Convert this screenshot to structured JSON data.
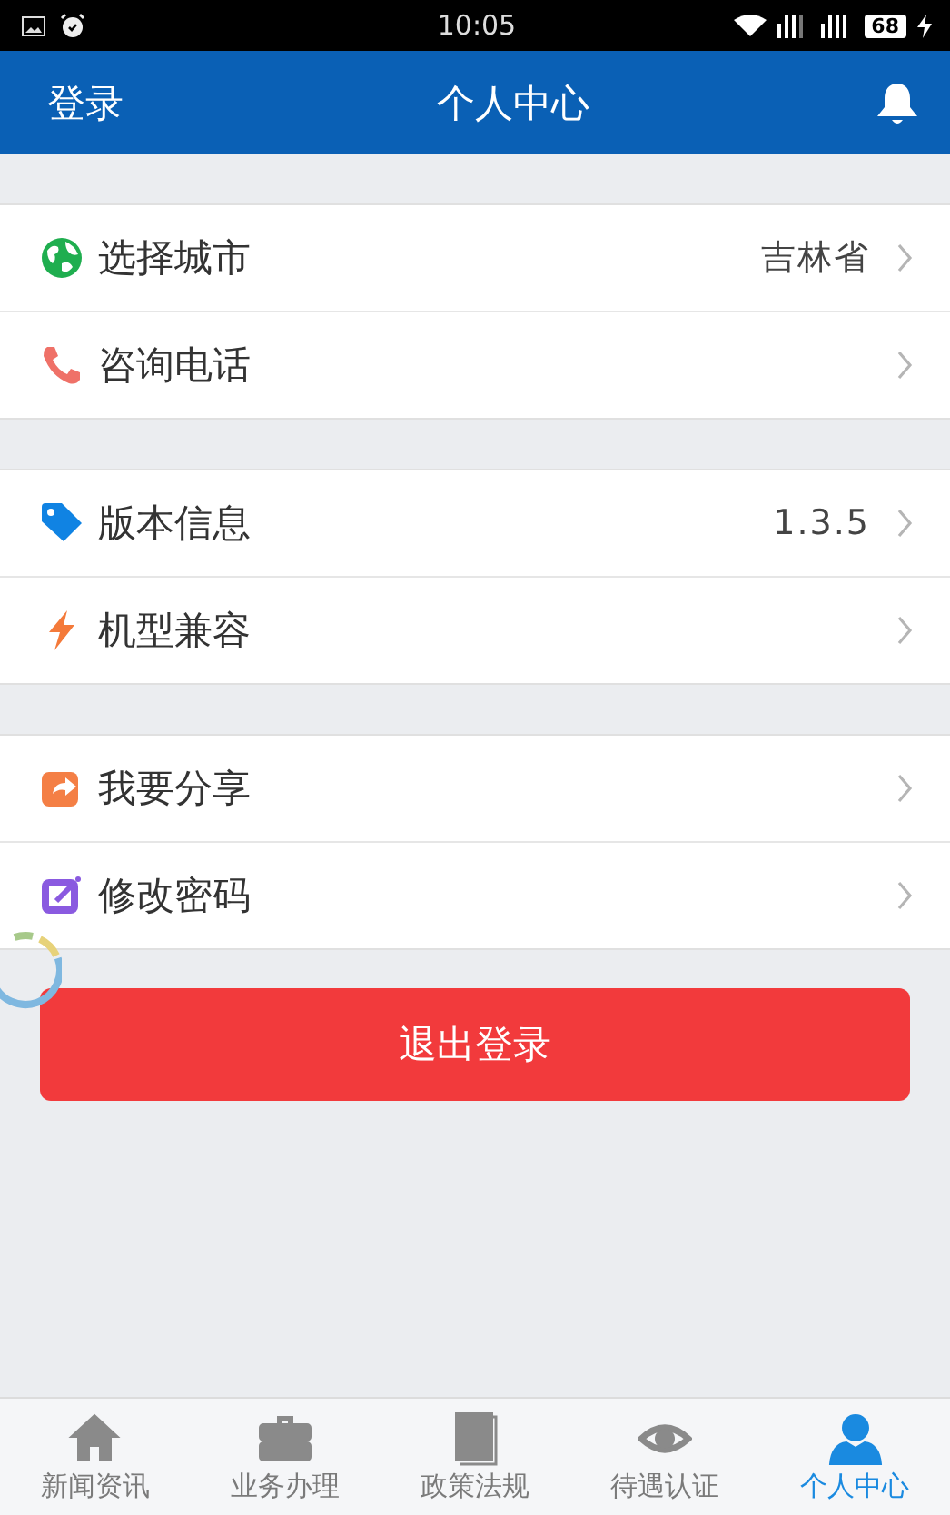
{
  "status_bar": {
    "time": "10:05",
    "battery": "68"
  },
  "header": {
    "left": "登录",
    "title": "个人中心"
  },
  "groups": [
    {
      "items": [
        {
          "label": "选择城市",
          "value": "吉林省"
        },
        {
          "label": "咨询电话"
        }
      ]
    },
    {
      "items": [
        {
          "label": "版本信息",
          "value": "1.3.5"
        },
        {
          "label": "机型兼容"
        }
      ]
    },
    {
      "items": [
        {
          "label": "我要分享"
        },
        {
          "label": "修改密码"
        }
      ]
    }
  ],
  "logout_button": "退出登录",
  "tabs": [
    {
      "label": "新闻资讯",
      "selected": false
    },
    {
      "label": "业务办理",
      "selected": false
    },
    {
      "label": "政策法规",
      "selected": false
    },
    {
      "label": "待遇认证",
      "selected": false
    },
    {
      "label": "个人中心",
      "selected": true
    }
  ]
}
